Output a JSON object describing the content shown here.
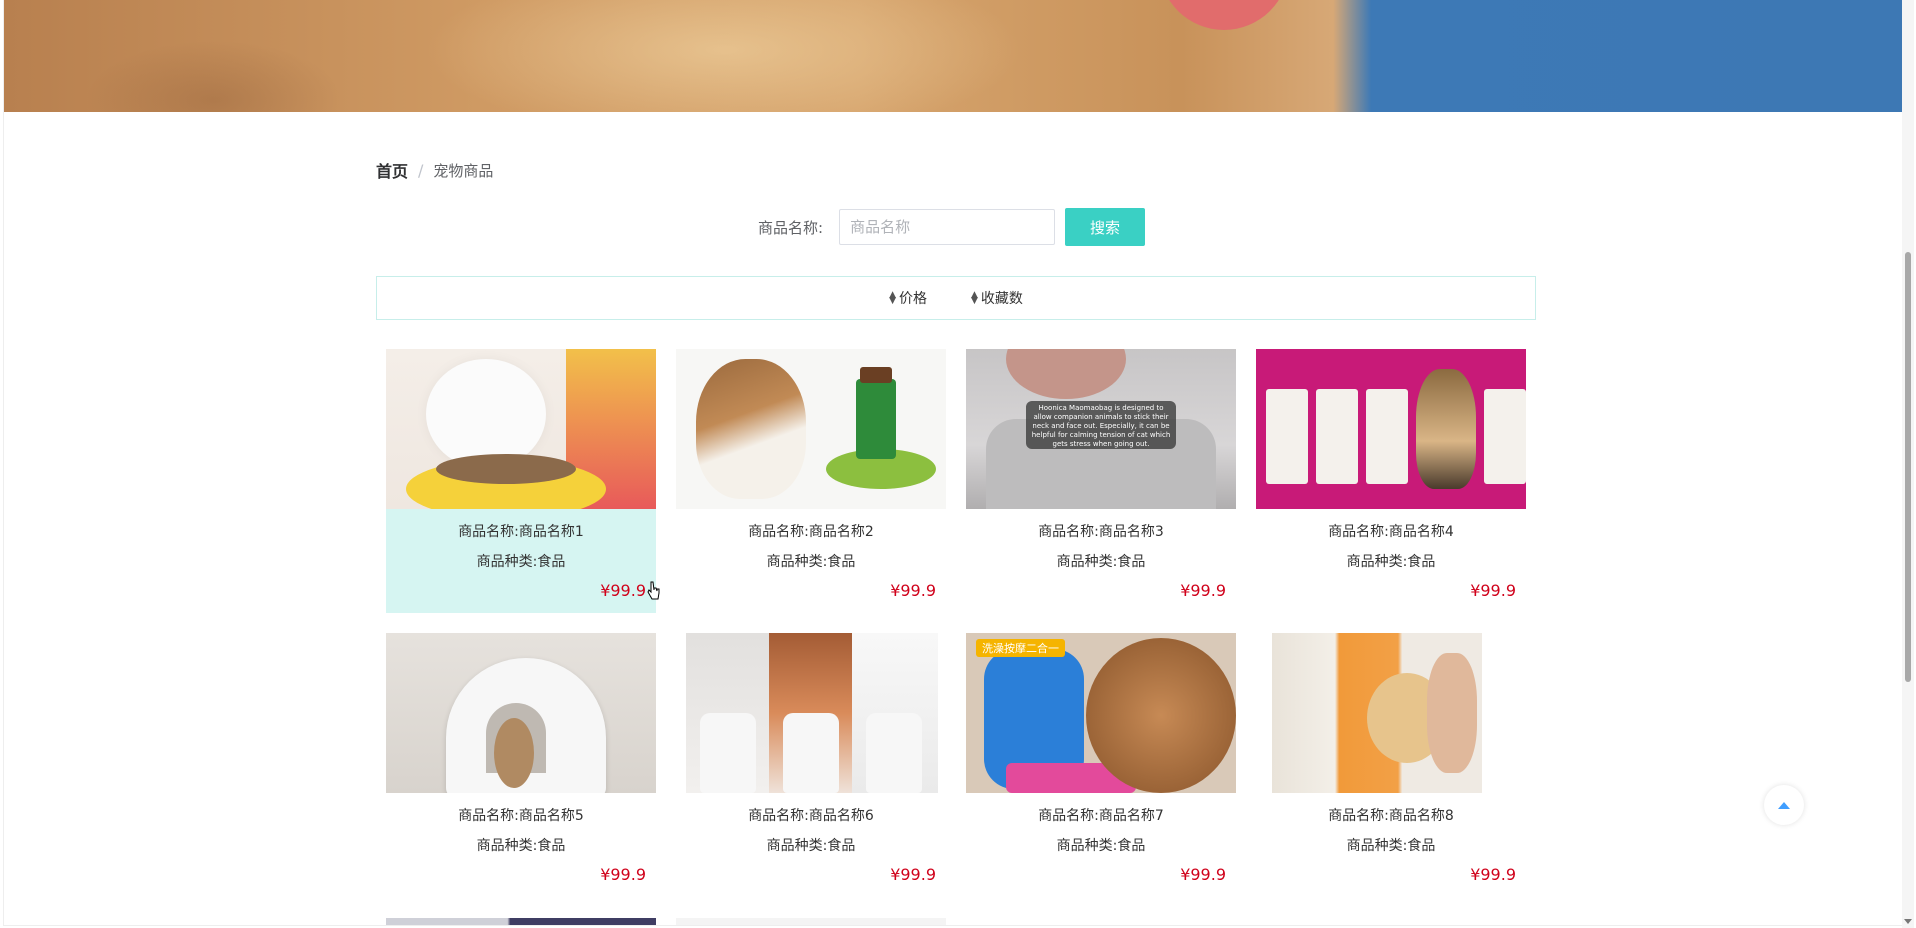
{
  "breadcrumb": {
    "home": "首页",
    "separator": "/",
    "current": "宠物商品"
  },
  "search": {
    "label": "商品名称:",
    "placeholder": "商品名称",
    "value": "",
    "button": "搜索"
  },
  "sort": {
    "items": [
      {
        "label": "价格",
        "icon": "sort-icon"
      },
      {
        "label": "收藏数",
        "icon": "sort-icon"
      }
    ]
  },
  "products": [
    {
      "name": "商品名称:商品名称1",
      "kind": "商品种类:食品",
      "price": "¥99.9"
    },
    {
      "name": "商品名称:商品名称2",
      "kind": "商品种类:食品",
      "price": "¥99.9"
    },
    {
      "name": "商品名称:商品名称3",
      "kind": "商品种类:食品",
      "price": "¥99.9"
    },
    {
      "name": "商品名称:商品名称4",
      "kind": "商品种类:食品",
      "price": "¥99.9"
    },
    {
      "name": "商品名称:商品名称5",
      "kind": "商品种类:食品",
      "price": "¥99.9"
    },
    {
      "name": "商品名称:商品名称6",
      "kind": "商品种类:食品",
      "price": "¥99.9"
    },
    {
      "name": "商品名称:商品名称7",
      "kind": "商品种类:食品",
      "price": "¥99.9"
    },
    {
      "name": "商品名称:商品名称8",
      "kind": "商品种类:食品",
      "price": "¥99.9"
    }
  ],
  "product3_caption": "Hoonica Maomaobag is designed to allow companion animals to stick their neck and face out. Especially, it can be helpful for calming tension of cat which gets stress when going out.",
  "product7_tag": "洗澡按摩二合一",
  "colors": {
    "accent": "#3ad0c4",
    "price": "#d0021b",
    "hover_card": "#d6f5f2",
    "back_top_icon": "#409eff"
  }
}
